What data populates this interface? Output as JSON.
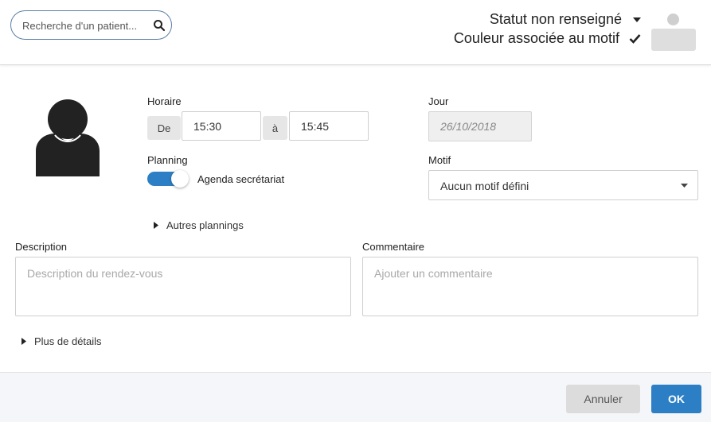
{
  "header": {
    "search": {
      "placeholder": "Recherche d'un patient..."
    },
    "status_label": "Statut non renseigné",
    "color_label": "Couleur associée au motif"
  },
  "form": {
    "horaire_label": "Horaire",
    "from_label": "De",
    "from_time": "15:30",
    "to_label": "à",
    "to_time": "15:45",
    "jour_label": "Jour",
    "jour_value": "26/10/2018",
    "planning_label": "Planning",
    "planning_toggle_text": "Agenda secrétariat",
    "motif_label": "Motif",
    "motif_value": "Aucun motif défini",
    "autres_plannings": "Autres plannings",
    "description_label": "Description",
    "description_placeholder": "Description du rendez-vous",
    "commentaire_label": "Commentaire",
    "commentaire_placeholder": "Ajouter un commentaire",
    "plus_details": "Plus de détails"
  },
  "footer": {
    "cancel_label": "Annuler",
    "ok_label": "OK"
  },
  "colors": {
    "accent": "#2d7fc5",
    "status_dot": "#cfcfcf",
    "motif_swatch": "#dedede"
  }
}
